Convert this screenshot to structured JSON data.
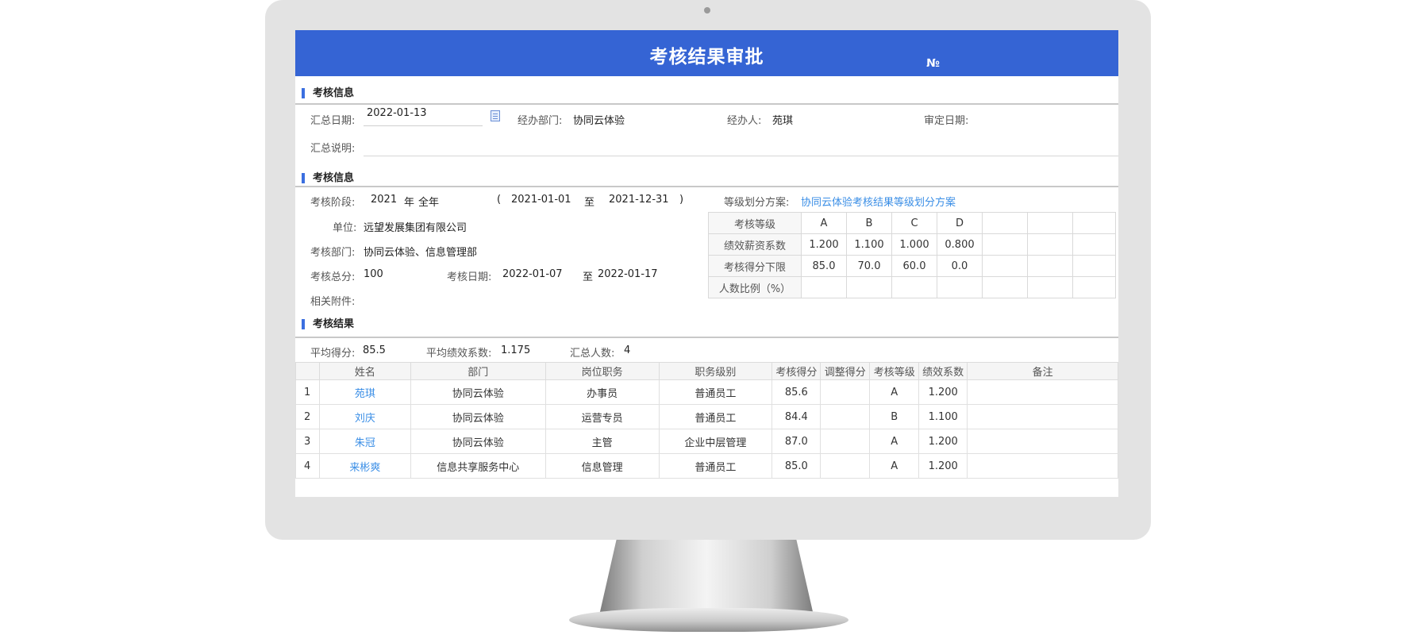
{
  "header": {
    "title": "考核结果审批",
    "number_sign": "№"
  },
  "summary_info": {
    "section_title": "考核信息",
    "summary_date_label": "汇总日期:",
    "summary_date_value": "2022-01-13",
    "dept_label": "经办部门:",
    "dept_value": "协同云体验",
    "handler_label": "经办人:",
    "handler_value": "苑琪",
    "approve_date_label": "审定日期:",
    "desc_label": "汇总说明:"
  },
  "assess_info": {
    "section_title": "考核信息",
    "stage_label": "考核阶段:",
    "stage_year": "2021",
    "stage_year_unit": "年",
    "stage_period": "全年",
    "paren_open": "(",
    "range_start": "2021-01-01",
    "range_to": "至",
    "range_end": "2021-12-31",
    "paren_close": ")",
    "scheme_label": "等级划分方案:",
    "scheme_value": "协同云体验考核结果等级划分方案",
    "unit_label": "单位:",
    "unit_value": "远望发展集团有限公司",
    "dept_label": "考核部门:",
    "dept_value": "协同云体验、信息管理部",
    "total_label": "考核总分:",
    "total_value": "100",
    "date_label": "考核日期:",
    "date_start": "2022-01-07",
    "date_to": "至",
    "date_end": "2022-01-17",
    "attach_label": "相关附件:"
  },
  "grade_table": {
    "rows": [
      {
        "header": "考核等级",
        "cells": [
          "A",
          "B",
          "C",
          "D"
        ]
      },
      {
        "header": "绩效薪资系数",
        "cells": [
          "1.200",
          "1.100",
          "1.000",
          "0.800"
        ]
      },
      {
        "header": "考核得分下限",
        "cells": [
          "85.0",
          "70.0",
          "60.0",
          "0.0"
        ]
      },
      {
        "header": "人数比例（%）",
        "cells": [
          "",
          "",
          "",
          ""
        ]
      }
    ]
  },
  "results": {
    "section_title": "考核结果",
    "avg_score_label": "平均得分:",
    "avg_score_value": "85.5",
    "avg_coef_label": "平均绩效系数:",
    "avg_coef_value": "1.175",
    "count_label": "汇总人数:",
    "count_value": "4",
    "columns": [
      "",
      "姓名",
      "部门",
      "岗位职务",
      "职务级别",
      "考核得分",
      "调整得分",
      "考核等级",
      "绩效系数",
      "备注"
    ],
    "rows": [
      [
        "1",
        "苑琪",
        "协同云体验",
        "办事员",
        "普通员工",
        "85.6",
        "",
        "A",
        "1.200",
        ""
      ],
      [
        "2",
        "刘庆",
        "协同云体验",
        "运营专员",
        "普通员工",
        "84.4",
        "",
        "B",
        "1.100",
        ""
      ],
      [
        "3",
        "朱冠",
        "协同云体验",
        "主管",
        "企业中层管理",
        "87.0",
        "",
        "A",
        "1.200",
        ""
      ],
      [
        "4",
        "来彬爽",
        "信息共享服务中心",
        "信息管理",
        "普通员工",
        "85.0",
        "",
        "A",
        "1.200",
        ""
      ]
    ]
  },
  "colors": {
    "title_bar": "#3564d4",
    "accent_link": "#3a8ee6",
    "section_marker": "#3b6fe0"
  }
}
